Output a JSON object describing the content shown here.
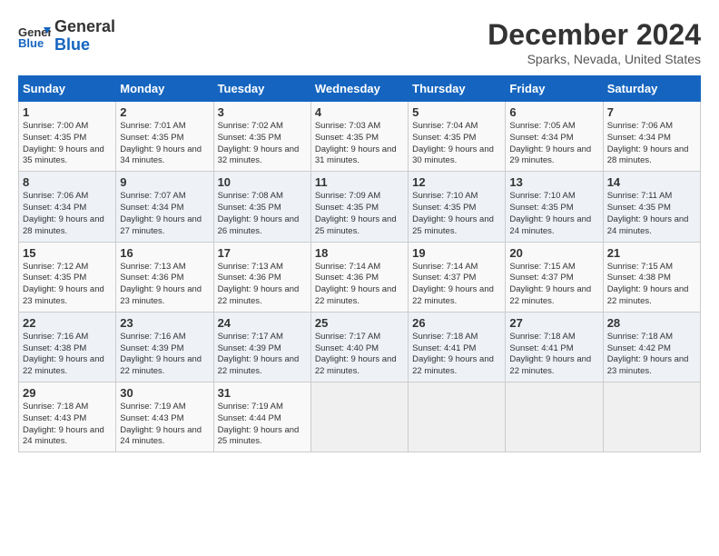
{
  "logo": {
    "line1": "General",
    "line2": "Blue"
  },
  "title": "December 2024",
  "location": "Sparks, Nevada, United States",
  "days_of_week": [
    "Sunday",
    "Monday",
    "Tuesday",
    "Wednesday",
    "Thursday",
    "Friday",
    "Saturday"
  ],
  "weeks": [
    [
      {
        "day": "1",
        "sunrise": "Sunrise: 7:00 AM",
        "sunset": "Sunset: 4:35 PM",
        "daylight": "Daylight: 9 hours and 35 minutes."
      },
      {
        "day": "2",
        "sunrise": "Sunrise: 7:01 AM",
        "sunset": "Sunset: 4:35 PM",
        "daylight": "Daylight: 9 hours and 34 minutes."
      },
      {
        "day": "3",
        "sunrise": "Sunrise: 7:02 AM",
        "sunset": "Sunset: 4:35 PM",
        "daylight": "Daylight: 9 hours and 32 minutes."
      },
      {
        "day": "4",
        "sunrise": "Sunrise: 7:03 AM",
        "sunset": "Sunset: 4:35 PM",
        "daylight": "Daylight: 9 hours and 31 minutes."
      },
      {
        "day": "5",
        "sunrise": "Sunrise: 7:04 AM",
        "sunset": "Sunset: 4:35 PM",
        "daylight": "Daylight: 9 hours and 30 minutes."
      },
      {
        "day": "6",
        "sunrise": "Sunrise: 7:05 AM",
        "sunset": "Sunset: 4:34 PM",
        "daylight": "Daylight: 9 hours and 29 minutes."
      },
      {
        "day": "7",
        "sunrise": "Sunrise: 7:06 AM",
        "sunset": "Sunset: 4:34 PM",
        "daylight": "Daylight: 9 hours and 28 minutes."
      }
    ],
    [
      {
        "day": "8",
        "sunrise": "Sunrise: 7:06 AM",
        "sunset": "Sunset: 4:34 PM",
        "daylight": "Daylight: 9 hours and 28 minutes."
      },
      {
        "day": "9",
        "sunrise": "Sunrise: 7:07 AM",
        "sunset": "Sunset: 4:34 PM",
        "daylight": "Daylight: 9 hours and 27 minutes."
      },
      {
        "day": "10",
        "sunrise": "Sunrise: 7:08 AM",
        "sunset": "Sunset: 4:35 PM",
        "daylight": "Daylight: 9 hours and 26 minutes."
      },
      {
        "day": "11",
        "sunrise": "Sunrise: 7:09 AM",
        "sunset": "Sunset: 4:35 PM",
        "daylight": "Daylight: 9 hours and 25 minutes."
      },
      {
        "day": "12",
        "sunrise": "Sunrise: 7:10 AM",
        "sunset": "Sunset: 4:35 PM",
        "daylight": "Daylight: 9 hours and 25 minutes."
      },
      {
        "day": "13",
        "sunrise": "Sunrise: 7:10 AM",
        "sunset": "Sunset: 4:35 PM",
        "daylight": "Daylight: 9 hours and 24 minutes."
      },
      {
        "day": "14",
        "sunrise": "Sunrise: 7:11 AM",
        "sunset": "Sunset: 4:35 PM",
        "daylight": "Daylight: 9 hours and 24 minutes."
      }
    ],
    [
      {
        "day": "15",
        "sunrise": "Sunrise: 7:12 AM",
        "sunset": "Sunset: 4:35 PM",
        "daylight": "Daylight: 9 hours and 23 minutes."
      },
      {
        "day": "16",
        "sunrise": "Sunrise: 7:13 AM",
        "sunset": "Sunset: 4:36 PM",
        "daylight": "Daylight: 9 hours and 23 minutes."
      },
      {
        "day": "17",
        "sunrise": "Sunrise: 7:13 AM",
        "sunset": "Sunset: 4:36 PM",
        "daylight": "Daylight: 9 hours and 22 minutes."
      },
      {
        "day": "18",
        "sunrise": "Sunrise: 7:14 AM",
        "sunset": "Sunset: 4:36 PM",
        "daylight": "Daylight: 9 hours and 22 minutes."
      },
      {
        "day": "19",
        "sunrise": "Sunrise: 7:14 AM",
        "sunset": "Sunset: 4:37 PM",
        "daylight": "Daylight: 9 hours and 22 minutes."
      },
      {
        "day": "20",
        "sunrise": "Sunrise: 7:15 AM",
        "sunset": "Sunset: 4:37 PM",
        "daylight": "Daylight: 9 hours and 22 minutes."
      },
      {
        "day": "21",
        "sunrise": "Sunrise: 7:15 AM",
        "sunset": "Sunset: 4:38 PM",
        "daylight": "Daylight: 9 hours and 22 minutes."
      }
    ],
    [
      {
        "day": "22",
        "sunrise": "Sunrise: 7:16 AM",
        "sunset": "Sunset: 4:38 PM",
        "daylight": "Daylight: 9 hours and 22 minutes."
      },
      {
        "day": "23",
        "sunrise": "Sunrise: 7:16 AM",
        "sunset": "Sunset: 4:39 PM",
        "daylight": "Daylight: 9 hours and 22 minutes."
      },
      {
        "day": "24",
        "sunrise": "Sunrise: 7:17 AM",
        "sunset": "Sunset: 4:39 PM",
        "daylight": "Daylight: 9 hours and 22 minutes."
      },
      {
        "day": "25",
        "sunrise": "Sunrise: 7:17 AM",
        "sunset": "Sunset: 4:40 PM",
        "daylight": "Daylight: 9 hours and 22 minutes."
      },
      {
        "day": "26",
        "sunrise": "Sunrise: 7:18 AM",
        "sunset": "Sunset: 4:41 PM",
        "daylight": "Daylight: 9 hours and 22 minutes."
      },
      {
        "day": "27",
        "sunrise": "Sunrise: 7:18 AM",
        "sunset": "Sunset: 4:41 PM",
        "daylight": "Daylight: 9 hours and 22 minutes."
      },
      {
        "day": "28",
        "sunrise": "Sunrise: 7:18 AM",
        "sunset": "Sunset: 4:42 PM",
        "daylight": "Daylight: 9 hours and 23 minutes."
      }
    ],
    [
      {
        "day": "29",
        "sunrise": "Sunrise: 7:18 AM",
        "sunset": "Sunset: 4:43 PM",
        "daylight": "Daylight: 9 hours and 24 minutes."
      },
      {
        "day": "30",
        "sunrise": "Sunrise: 7:19 AM",
        "sunset": "Sunset: 4:43 PM",
        "daylight": "Daylight: 9 hours and 24 minutes."
      },
      {
        "day": "31",
        "sunrise": "Sunrise: 7:19 AM",
        "sunset": "Sunset: 4:44 PM",
        "daylight": "Daylight: 9 hours and 25 minutes."
      },
      null,
      null,
      null,
      null
    ]
  ]
}
